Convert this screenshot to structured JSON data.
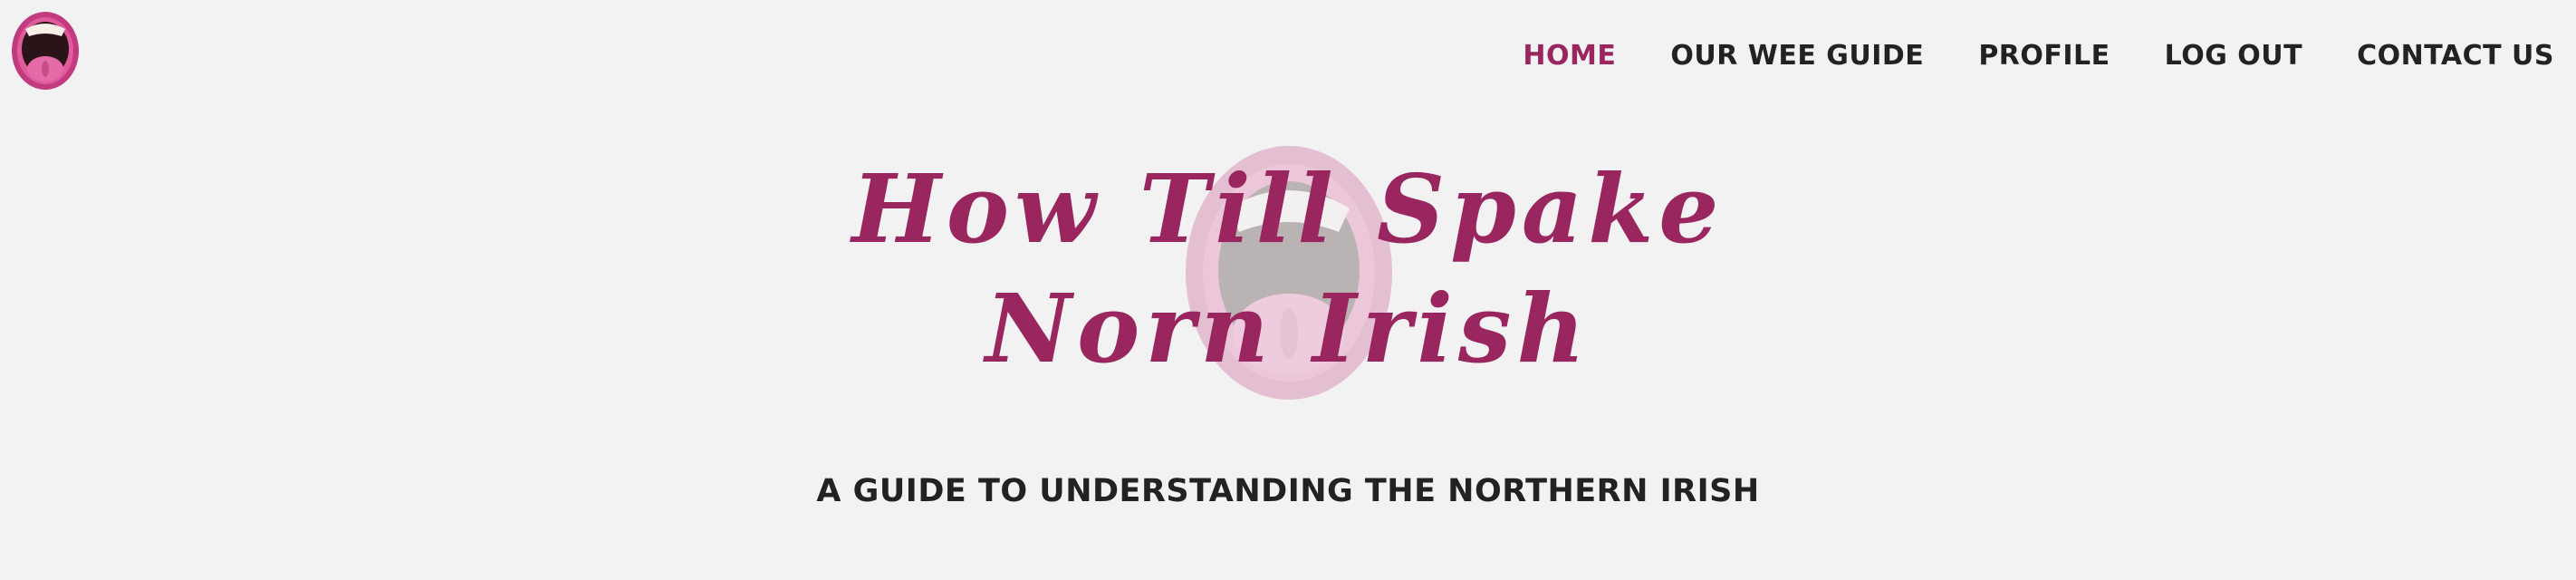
{
  "logo": {
    "icon": "open-mouth-icon"
  },
  "nav": {
    "items": [
      {
        "label": "HOME",
        "active": true
      },
      {
        "label": "OUR WEE GUIDE",
        "active": false
      },
      {
        "label": "PROFILE",
        "active": false
      },
      {
        "label": "LOG OUT",
        "active": false
      },
      {
        "label": "CONTACT US",
        "active": false
      }
    ]
  },
  "hero": {
    "title_line1": "How Till Spake",
    "title_line2": "Norn Irish",
    "subtitle": "A GUIDE TO UNDERSTANDING THE NORTHERN IRISH",
    "background_icon": "open-mouth-icon"
  },
  "colors": {
    "accent": "#9a2660",
    "background": "#f2f2f2",
    "text": "#222222"
  }
}
